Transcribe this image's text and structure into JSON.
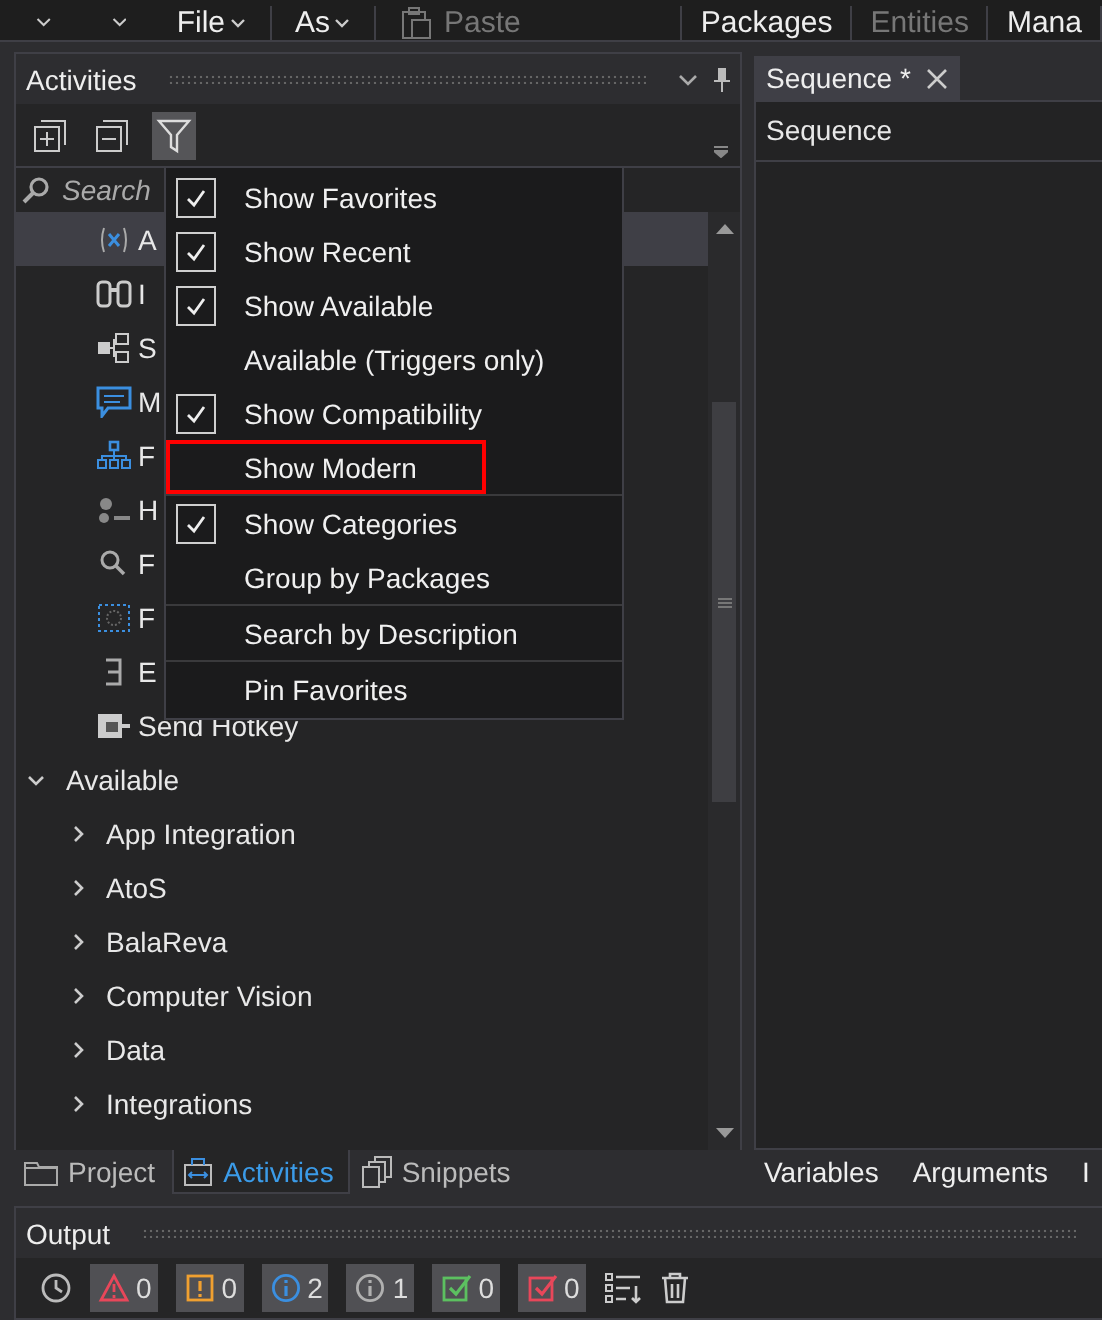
{
  "ribbon": {
    "items": [
      {
        "kind": "caret"
      },
      {
        "kind": "caret"
      },
      {
        "kind": "menu",
        "label": "File",
        "disabled": false
      },
      {
        "kind": "menu",
        "label": "As",
        "disabled": false
      },
      {
        "kind": "paste",
        "label": "Paste",
        "disabled": true
      },
      {
        "kind": "tab",
        "label": "Packages",
        "disabled": false
      },
      {
        "kind": "tab",
        "label": "Entities",
        "disabled": true
      },
      {
        "kind": "tab",
        "label": "Mana",
        "disabled": false
      }
    ]
  },
  "activities_panel": {
    "title": "Activities",
    "search": {
      "placeholder": "Search"
    },
    "filter_pressed": true,
    "recent": [
      {
        "label": "A",
        "selected": true
      },
      {
        "label": "I",
        "selected": false
      },
      {
        "label": "S",
        "selected": false
      },
      {
        "label": "M",
        "selected": false
      },
      {
        "label": "F",
        "selected": false
      },
      {
        "label": "H",
        "selected": false
      },
      {
        "label": "F",
        "selected": false
      },
      {
        "label": "F",
        "selected": false
      },
      {
        "label": "E",
        "selected": false
      },
      {
        "label": "Send Hotkey",
        "selected": false
      }
    ],
    "groups": [
      {
        "label": "Available",
        "expanded": true,
        "children": [
          {
            "label": "App Integration",
            "expanded": false
          },
          {
            "label": "AtoS",
            "expanded": false
          },
          {
            "label": "BalaReva",
            "expanded": false
          },
          {
            "label": "Computer Vision",
            "expanded": false
          },
          {
            "label": "Data",
            "expanded": false
          },
          {
            "label": "Integrations",
            "expanded": false
          }
        ]
      }
    ],
    "filter_menu": [
      {
        "label": "Show Favorites",
        "checked": true,
        "separator_before": false,
        "highlighted": false
      },
      {
        "label": "Show Recent",
        "checked": true,
        "separator_before": false,
        "highlighted": false
      },
      {
        "label": "Show Available",
        "checked": true,
        "separator_before": false,
        "highlighted": false
      },
      {
        "label": "Available (Triggers only)",
        "checked": false,
        "separator_before": false,
        "highlighted": false
      },
      {
        "label": "Show Compatibility",
        "checked": true,
        "separator_before": false,
        "highlighted": false
      },
      {
        "label": "Show Modern",
        "checked": false,
        "separator_before": false,
        "highlighted": true
      },
      {
        "label": "Show Categories",
        "checked": true,
        "separator_before": true,
        "highlighted": false
      },
      {
        "label": "Group by Packages",
        "checked": false,
        "separator_before": false,
        "highlighted": false
      },
      {
        "label": "Search by Description",
        "checked": false,
        "separator_before": true,
        "highlighted": false
      },
      {
        "label": "Pin Favorites",
        "checked": false,
        "separator_before": true,
        "highlighted": false
      }
    ],
    "bottom_tabs": [
      {
        "kind": "folder",
        "label": "Project",
        "selected": false
      },
      {
        "kind": "activities",
        "label": "Activities",
        "selected": true
      },
      {
        "kind": "snippets",
        "label": "Snippets",
        "selected": false
      }
    ]
  },
  "designer": {
    "tab": {
      "label": "Sequence *"
    },
    "header": "Sequence",
    "bottom_tabs": [
      "Variables",
      "Arguments",
      "I"
    ]
  },
  "output": {
    "title": "Output",
    "filters": [
      {
        "kind": "error",
        "count": "0",
        "on": true
      },
      {
        "kind": "warning",
        "count": "0",
        "on": true
      },
      {
        "kind": "info",
        "count": "2",
        "on": true
      },
      {
        "kind": "trace",
        "count": "1",
        "on": true
      },
      {
        "kind": "success",
        "count": "0",
        "on": true
      },
      {
        "kind": "failure",
        "count": "0",
        "on": true
      }
    ]
  }
}
